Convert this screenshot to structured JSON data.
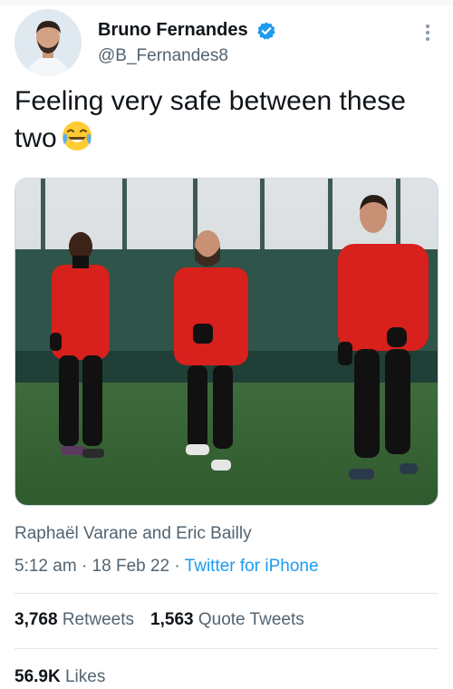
{
  "tweet": {
    "author": {
      "display_name": "Bruno Fernandes",
      "handle": "@B_Fernandes8",
      "verified": true,
      "avatar_icon": "profile-photo"
    },
    "text": "Feeling very safe between these two",
    "emoji": "face-with-tears-of-joy",
    "media": {
      "type": "photo",
      "description_icon": "three-footballers-training-photo"
    },
    "media_caption": "Raphaël Varane and Eric Bailly",
    "time": "5:12 am",
    "date": "18 Feb 22",
    "source": "Twitter for iPhone",
    "retweets_count": "3,768",
    "retweets_label": "Retweets",
    "quote_count": "1,563",
    "quote_label": "Quote Tweets",
    "likes_count": "56.9K",
    "likes_label": "Likes"
  },
  "colors": {
    "link": "#1d9bf0",
    "secondary_text": "#536471",
    "primary_text": "#0f1419",
    "verified_badge": "#1d9bf0",
    "kit_red": "#d8201c"
  }
}
